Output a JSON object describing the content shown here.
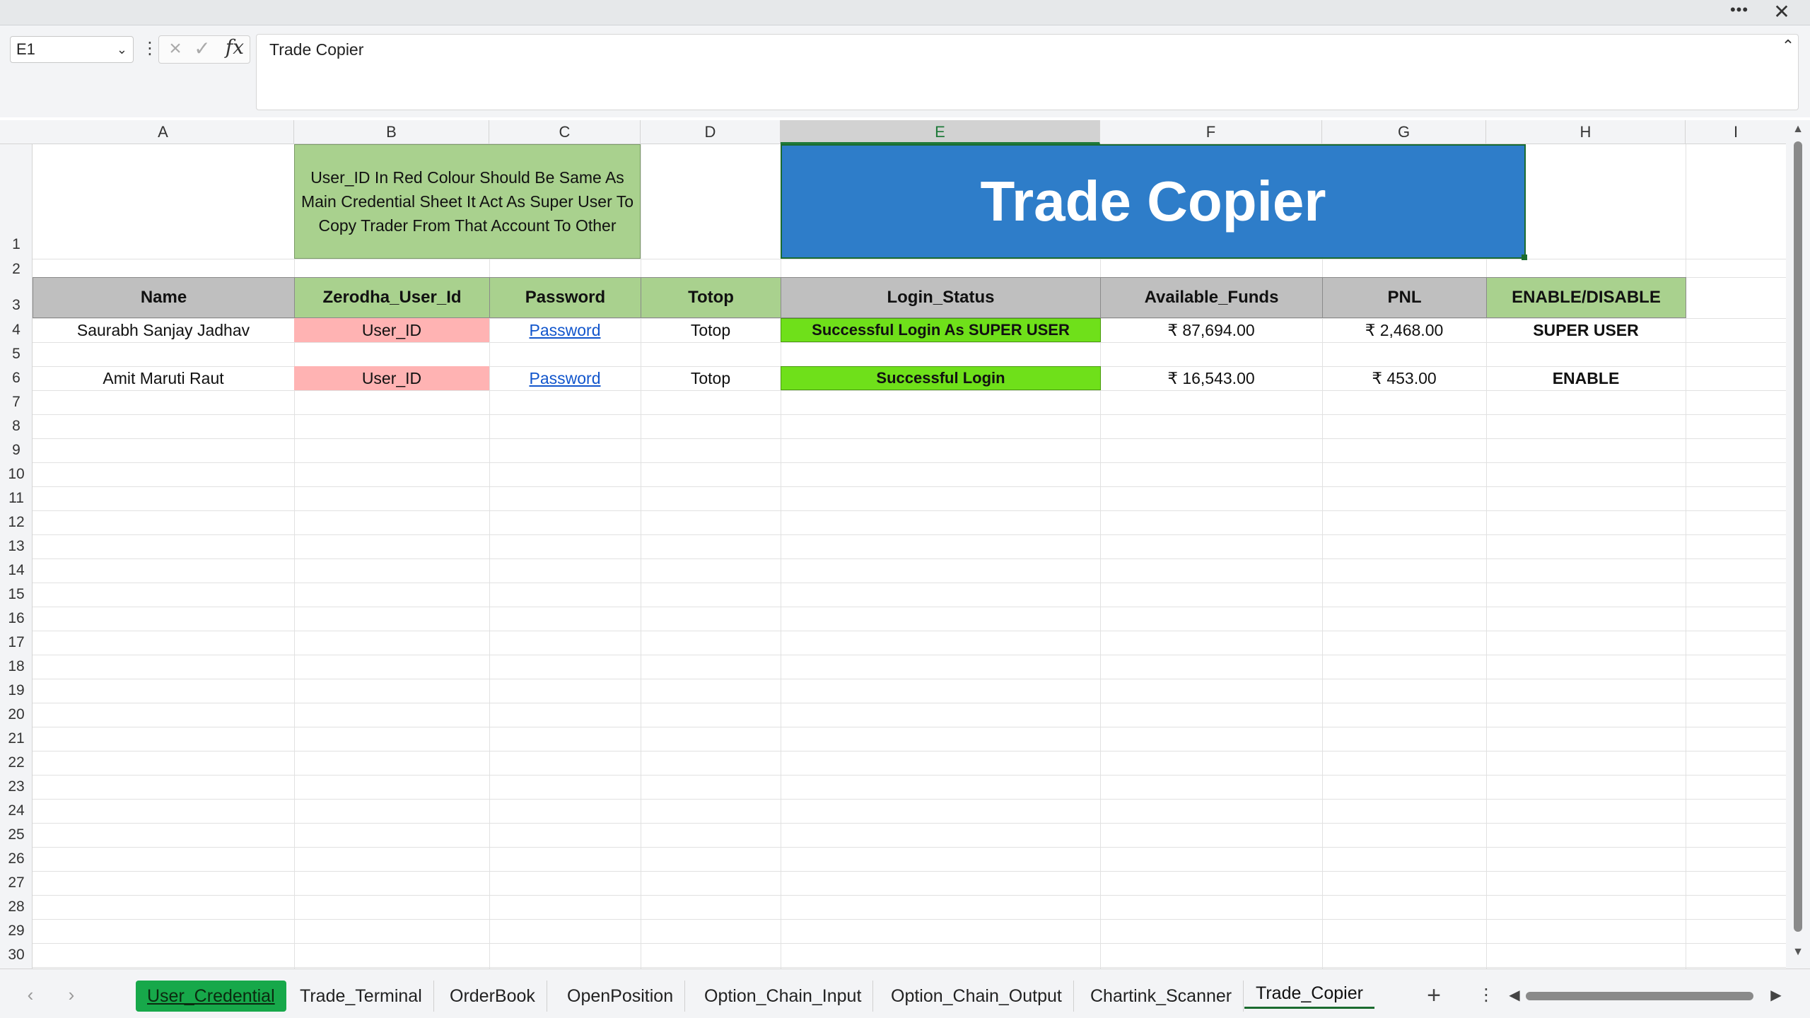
{
  "window": {
    "more_icon": "ellipsis-icon",
    "close_icon": "close-icon"
  },
  "formula_bar": {
    "name_box": "E1",
    "content": "Trade Copier",
    "fx_label": "fx"
  },
  "columns": [
    "A",
    "B",
    "C",
    "D",
    "E",
    "F",
    "G",
    "H",
    "I"
  ],
  "selected_column": "E",
  "rows": [
    "1",
    "2",
    "3",
    "4",
    "5",
    "6",
    "7",
    "8",
    "9",
    "10",
    "11",
    "12",
    "13",
    "14",
    "15",
    "16",
    "17",
    "18",
    "19",
    "20",
    "21",
    "22",
    "23",
    "24",
    "25",
    "26",
    "27",
    "28",
    "29",
    "30"
  ],
  "note": "User_ID In Red Colour Should Be Same As Main Credential Sheet It Act As Super User To Copy Trader From That Account To Other",
  "title": "Trade Copier",
  "headers": {
    "name": "Name",
    "user_id": "Zerodha_User_Id",
    "password": "Password",
    "totop": "Totop",
    "login_status": "Login_Status",
    "funds": "Available_Funds",
    "pnl": "PNL",
    "enable": "ENABLE/DISABLE"
  },
  "accounts": [
    {
      "name": "Saurabh Sanjay Jadhav",
      "user_id": "User_ID",
      "password": "Password",
      "totop": "Totop",
      "login_status": "Successful Login As SUPER USER",
      "funds": "₹ 87,694.00",
      "pnl": "₹ 2,468.00",
      "enable": "SUPER USER"
    },
    {
      "name": "Amit Maruti Raut",
      "user_id": "User_ID",
      "password": "Password",
      "totop": "Totop",
      "login_status": "Successful Login",
      "funds": "₹ 16,543.00",
      "pnl": "₹ 453.00",
      "enable": "ENABLE"
    }
  ],
  "sheet_tabs": [
    "User_Credential",
    "Trade_Terminal",
    "OrderBook",
    "OpenPosition",
    "Option_Chain_Input",
    "Option_Chain_Output",
    "Chartink_Scanner",
    "Trade_Copier"
  ],
  "active_sheet": "Trade_Copier",
  "colors": {
    "header_gray": "#bfbfbf",
    "header_green": "#a9d18e",
    "title_blue": "#2e7dc9",
    "status_green": "#6fe01a",
    "user_id_pink": "#ffb3b3",
    "tab_green": "#17a84a"
  }
}
